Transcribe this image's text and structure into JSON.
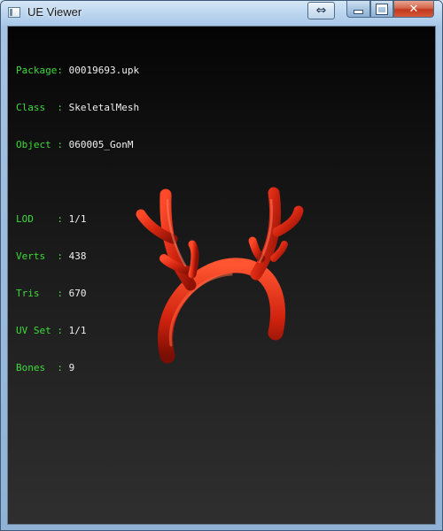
{
  "window": {
    "title": "UE Viewer",
    "swap_glyph": "⇔",
    "close_glyph": "✕"
  },
  "info_rows": [
    {
      "key": "Package: ",
      "value": "00019693.upk"
    },
    {
      "key": "Class  : ",
      "value": "SkeletalMesh"
    },
    {
      "key": "Object : ",
      "value": "060005_GonM"
    },
    {
      "key": "LOD    : ",
      "value": "1/1"
    },
    {
      "key": "Verts  : ",
      "value": "438"
    },
    {
      "key": "Tris   : ",
      "value": "670"
    },
    {
      "key": "UV Set : ",
      "value": "1/1"
    },
    {
      "key": "Bones  : ",
      "value": "9"
    }
  ],
  "colors": {
    "label": "#3ddc38",
    "value": "#f0f0f0",
    "mesh": "#d42611"
  },
  "icons": [
    "app-window-icon",
    "swap-icon",
    "minimize-icon",
    "maximize-icon",
    "close-icon"
  ]
}
